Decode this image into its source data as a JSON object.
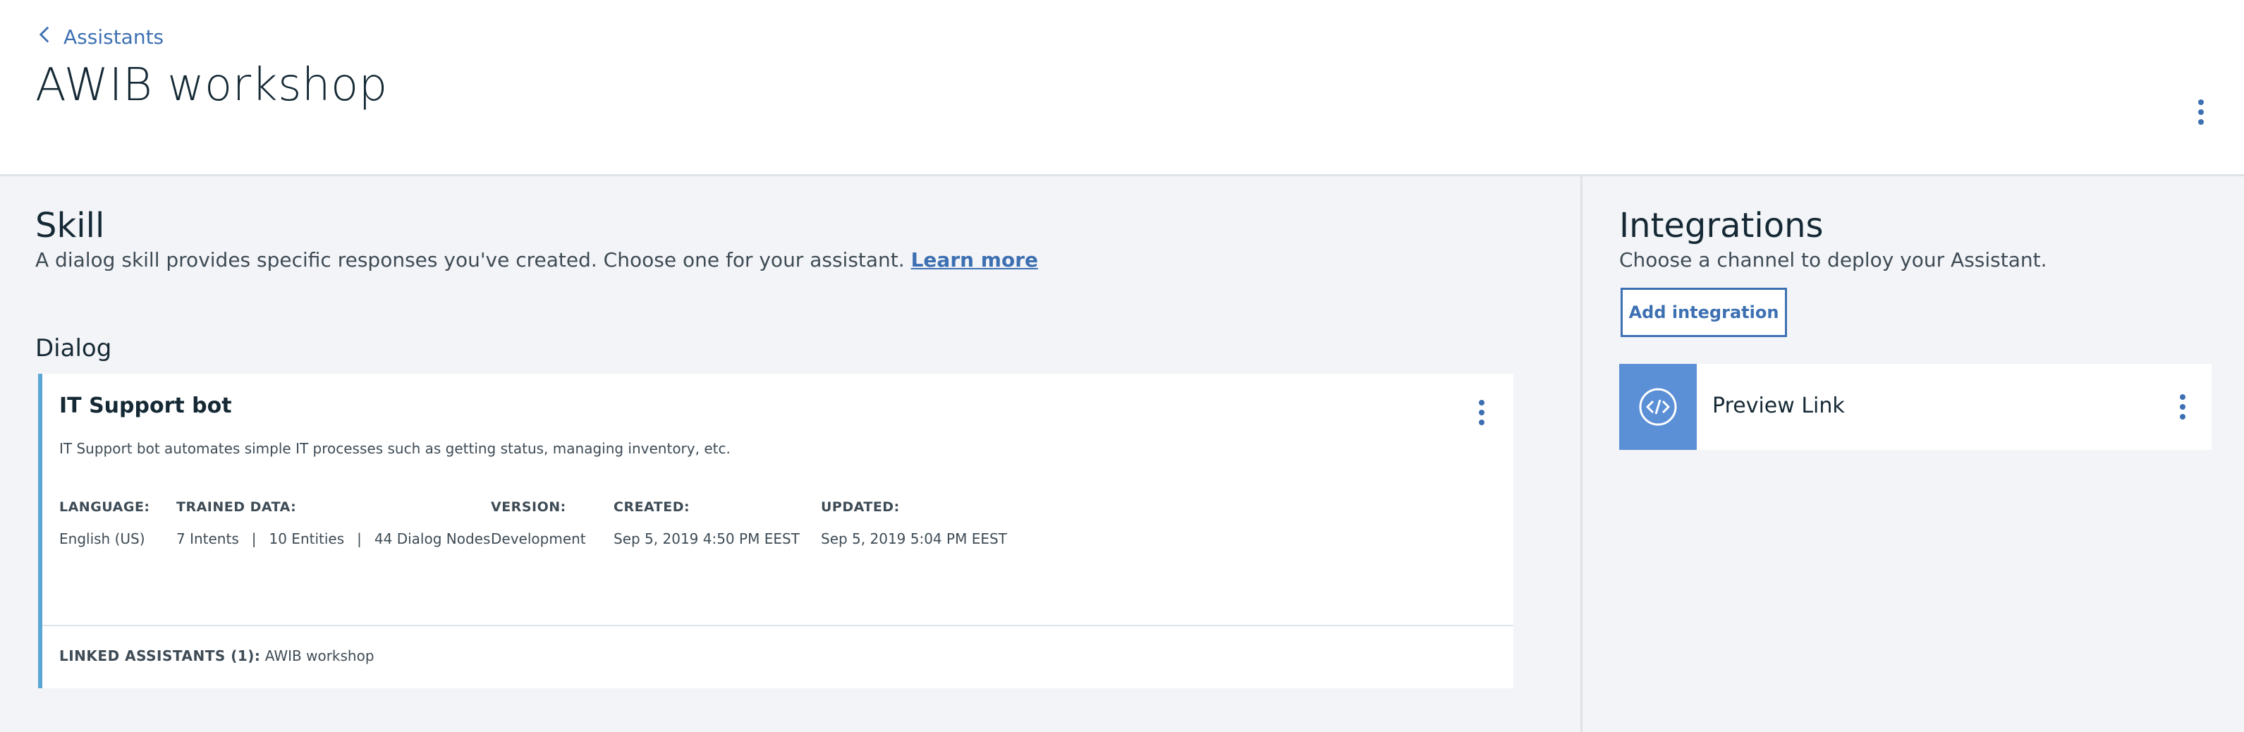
{
  "header": {
    "back_label": "Assistants",
    "title": "AWIB workshop"
  },
  "skill": {
    "title": "Skill",
    "description": "A dialog skill provides specific responses you've created. Choose one for your assistant.",
    "learn_more": "Learn more",
    "dialog_label": "Dialog",
    "card": {
      "name": "IT Support bot",
      "description": "IT Support bot automates simple IT processes such as getting status, managing inventory, etc.",
      "language_label": "LANGUAGE:",
      "language_value": "English (US)",
      "trained_label": "TRAINED DATA:",
      "intents": "7 Intents",
      "entities": "10 Entities",
      "dialog_nodes": "44 Dialog Nodes",
      "separator": "|",
      "version_label": "VERSION:",
      "version_value": "Development",
      "created_label": "CREATED:",
      "created_value": "Sep 5, 2019 4:50 PM EEST",
      "updated_label": "UPDATED:",
      "updated_value": "Sep 5, 2019 5:04 PM EEST",
      "linked_label": "LINKED ASSISTANTS (1):",
      "linked_value": "AWIB workshop"
    }
  },
  "integrations": {
    "title": "Integrations",
    "description": "Choose a channel to deploy your Assistant.",
    "add_button": "Add integration",
    "items": [
      {
        "name": "Preview Link",
        "icon": "code-icon"
      }
    ]
  },
  "colors": {
    "accent": "#3d70b2",
    "card_border": "#5aa7d6",
    "integration_icon_bg": "#5b8fd6",
    "background": "#f3f4f7"
  }
}
